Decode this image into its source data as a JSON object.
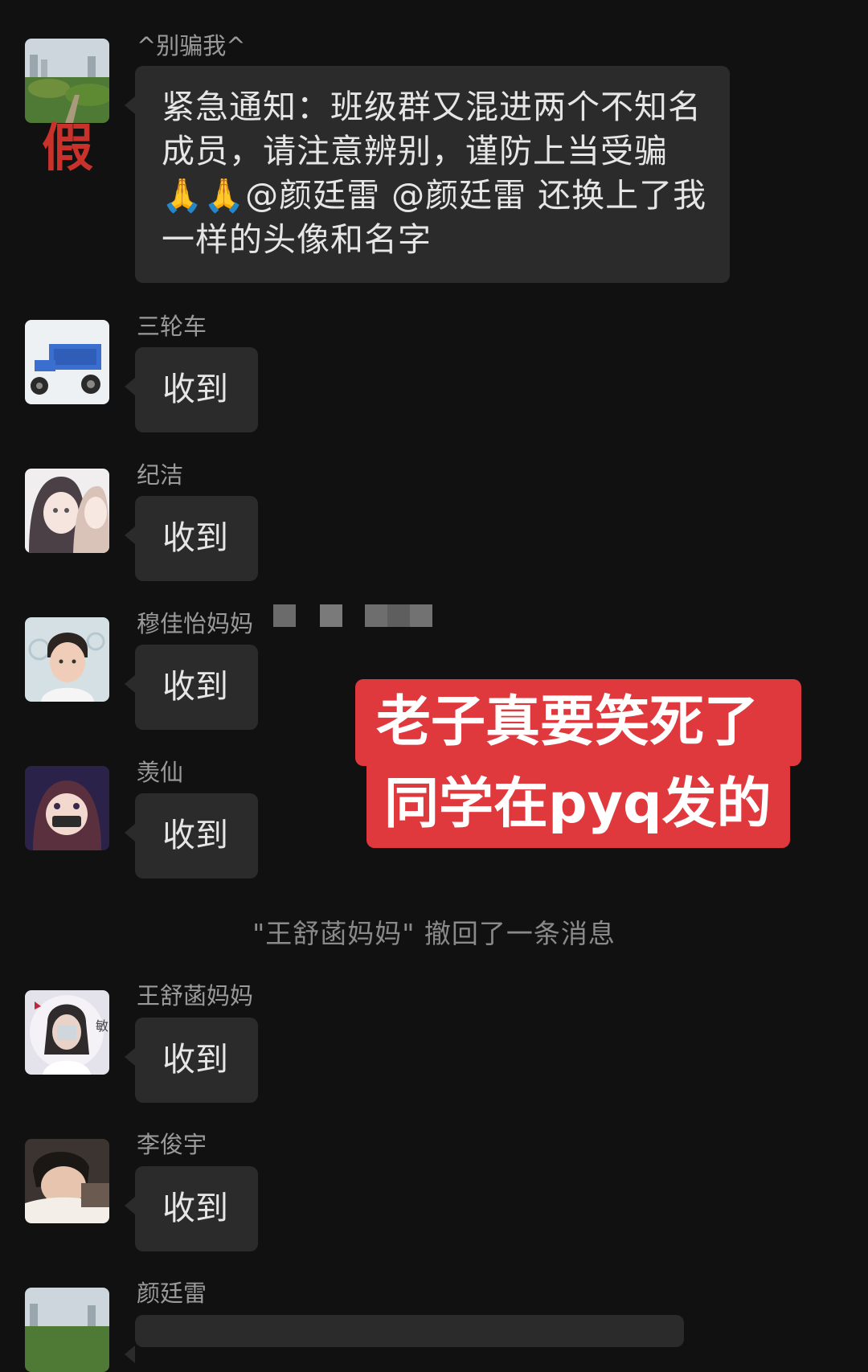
{
  "messages": [
    {
      "name": "^别骗我^",
      "text": "紧急通知：班级群又混进两个不知名成员，请注意辨别，谨防上当受骗🙏🙏@颜廷雷 @颜廷雷 还换上了我一样的头像和名字",
      "tag": "假"
    },
    {
      "name": "三轮车",
      "text": "收到"
    },
    {
      "name": "纪洁",
      "text": "收到"
    },
    {
      "name": "穆佳怡妈妈",
      "text": "收到"
    },
    {
      "name": "羡仙",
      "text": "收到"
    },
    {
      "name": "王舒菡妈妈",
      "text": "收到"
    },
    {
      "name": "李俊宇",
      "text": "收到"
    },
    {
      "name": "颜廷雷",
      "text": ""
    }
  ],
  "system_notice": "\"王舒菡妈妈\" 撤回了一条消息",
  "overlay": {
    "line1": "老子真要笑死了",
    "line2": "同学在pyq发的",
    "color": "#e0393d"
  },
  "colors": {
    "background": "#111111",
    "bubble": "#2b2b2b",
    "fake_tag": "#c8322b"
  }
}
